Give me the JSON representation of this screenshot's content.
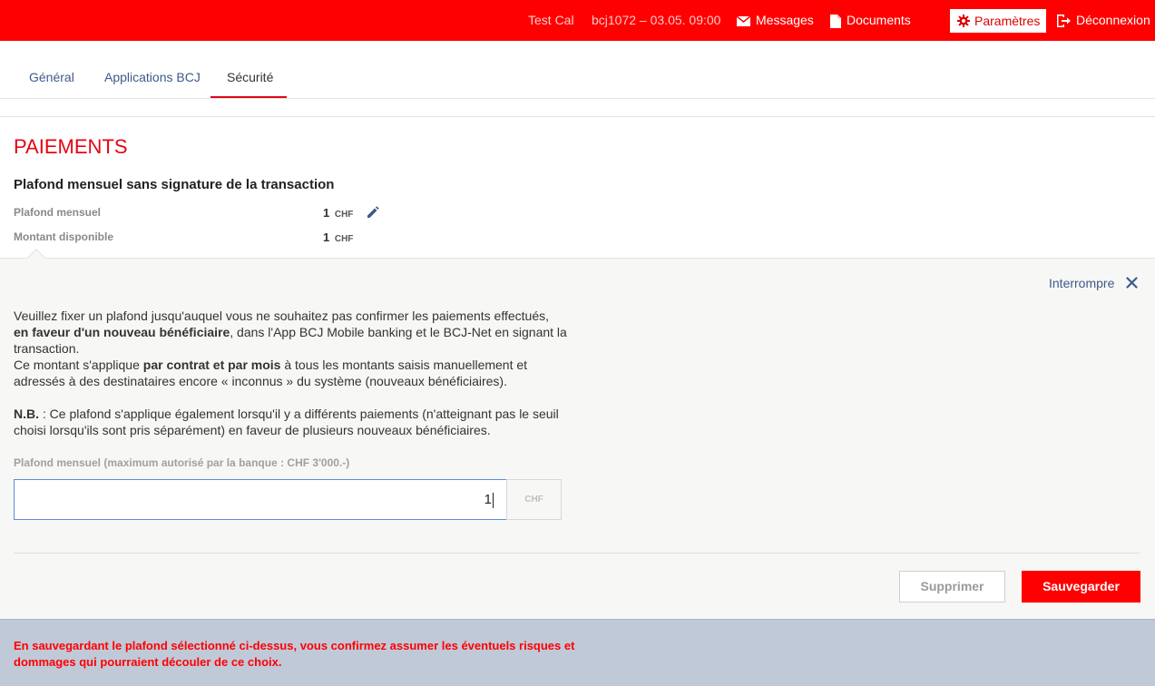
{
  "header": {
    "user": "Test Cal",
    "session": "bcj1072 – 03.05. 09:00",
    "messages": "Messages",
    "documents": "Documents",
    "settings": "Paramètres",
    "logout": "Déconnexion"
  },
  "tabs": [
    {
      "label": "Général",
      "active": false
    },
    {
      "label": "Applications BCJ",
      "active": false
    },
    {
      "label": "Sécurité",
      "active": true
    }
  ],
  "section": {
    "title": "PAIEMENTS",
    "subtitle": "Plafond mensuel sans signature de la transaction",
    "rows": [
      {
        "label": "Plafond mensuel",
        "value": "1",
        "currency": "CHF"
      },
      {
        "label": "Montant disponible",
        "value": "1",
        "currency": "CHF"
      }
    ]
  },
  "panel": {
    "interrupt": "Interrompre",
    "p1_a": "Veuillez fixer un plafond jusqu'auquel vous ne souhaitez pas confirmer les paiements effectués, ",
    "p1_b": "en faveur d'un nouveau bénéficiaire",
    "p1_c": ", dans l'App BCJ Mobile banking et le BCJ-Net en signant la transaction.",
    "p2_a": "Ce montant s'applique ",
    "p2_b": "par contrat et par mois",
    "p2_c": " à tous les montants saisis manuellement et adressés à des destinataires encore « inconnus » du système (nouveaux bénéficiaires).",
    "nb_label": "N.B.",
    "nb_text": " : Ce plafond s'applique également lorsqu'il y a différents paiements (n'atteignant pas le seuil choisi lorsqu'ils sont pris séparément) en faveur de plusieurs nouveaux bénéficiaires.",
    "field_label": "Plafond mensuel (maximum autorisé par la banque : CHF 3'000.-)",
    "input_value": "1",
    "input_currency": "CHF",
    "delete_label": "Supprimer",
    "save_label": "Sauvegarder"
  },
  "footer": {
    "warning": "En sauvegardant le plafond sélectionné ci-dessus, vous confirmez assumer les éventuels risques et dommages qui pourraient découler de ce choix."
  },
  "colors": {
    "brand_red": "#ff0000",
    "link_blue": "#3d5a8a",
    "footer_bg": "#c0c9d8"
  }
}
